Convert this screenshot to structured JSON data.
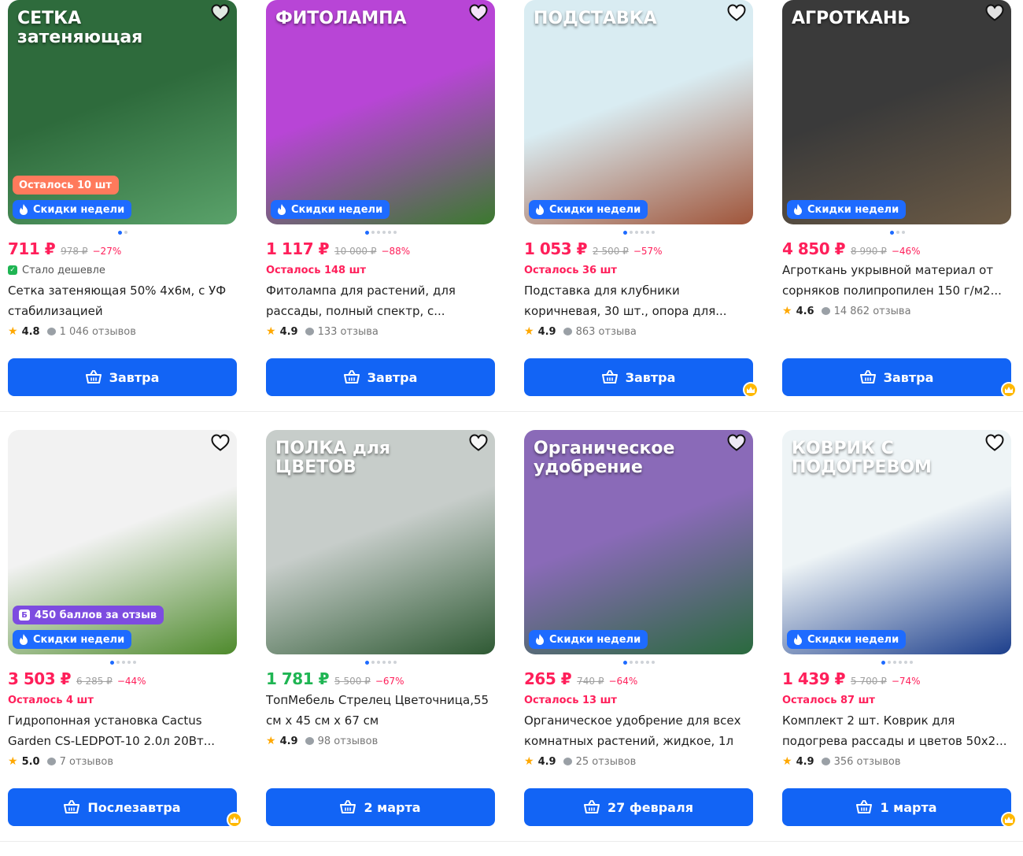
{
  "rows": [
    [
      {
        "price": "711 ₽",
        "old_price": "978 ₽",
        "discount": "−27%",
        "sub_type": "cheaper",
        "sub_text": "Стало дешевле",
        "title": "Сетка затеняющая 50% 4х6м, с УФ стабилизацией",
        "rating": "4.8",
        "reviews": "1 046 отзывов",
        "delivery": "Завтра",
        "badges": {
          "left": "Осталось 10 шт",
          "sale": "Скидки недели"
        },
        "dots": 2,
        "active_dot": 0,
        "crown": false,
        "image_colors": [
          "#2e6b3c",
          "#5aa26a"
        ],
        "image_label": "СЕТКА затеняющая"
      },
      {
        "price": "1 117 ₽",
        "old_price": "10 000 ₽",
        "discount": "−88%",
        "sub_type": "red",
        "sub_text": "Осталось 148 шт",
        "title": "Фитолампа для растений, для рассады, полный спектр, с...",
        "rating": "4.9",
        "reviews": "133 отзыва",
        "delivery": "Завтра",
        "badges": {
          "sale": "Скидки недели"
        },
        "dots": 6,
        "active_dot": 0,
        "crown": false,
        "image_colors": [
          "#b845d6",
          "#3b7a2e"
        ],
        "image_label": "ФИТОЛАМПА"
      },
      {
        "price": "1 053 ₽",
        "old_price": "2 500 ₽",
        "discount": "−57%",
        "sub_type": "red",
        "sub_text": "Осталось 36 шт",
        "title": "Подставка для клубники коричневая, 30 шт., опора для...",
        "rating": "4.9",
        "reviews": "863 отзыва",
        "delivery": "Завтра",
        "badges": {
          "sale": "Скидки недели"
        },
        "dots": 6,
        "active_dot": 0,
        "crown": true,
        "image_colors": [
          "#d9ecf2",
          "#a0553a"
        ],
        "image_label": "ПОДСТАВКА"
      },
      {
        "price": "4 850 ₽",
        "old_price": "8 990 ₽",
        "discount": "−46%",
        "sub_type": "none",
        "sub_text": "",
        "title": "Агроткань укрывной материал от сорняков полипропилен 150 г/м2...",
        "rating": "4.6",
        "reviews": "14 862 отзыва",
        "delivery": "Завтра",
        "badges": {
          "sale": "Скидки недели"
        },
        "dots": 3,
        "active_dot": 0,
        "crown": true,
        "image_colors": [
          "#3a3a3a",
          "#6b5a45"
        ],
        "image_label": "АГРОТКАНЬ"
      }
    ],
    [
      {
        "price": "3 503 ₽",
        "old_price": "6 285 ₽",
        "discount": "−44%",
        "sub_type": "red",
        "sub_text": "Осталось 4 шт",
        "title": "Гидропонная установка Cactus Garden CS-LEDPOT-10 2.0л 20Вт...",
        "rating": "5.0",
        "reviews": "7 отзывов",
        "delivery": "Послезавтра",
        "badges": {
          "points": "450 баллов за отзыв",
          "sale": "Скидки недели"
        },
        "dots": 5,
        "active_dot": 0,
        "crown": true,
        "image_colors": [
          "#f2f2f2",
          "#4e8a2c"
        ],
        "image_label": ""
      },
      {
        "price": "1 781 ₽",
        "old_price": "5 500 ₽",
        "discount": "−67%",
        "price_green": true,
        "sub_type": "none",
        "sub_text": "",
        "title": "ТопМебель Стрелец Цветочница,55 см х 45 см х 67 см",
        "rating": "4.9",
        "reviews": "98 отзывов",
        "delivery": "2 марта",
        "badges": {},
        "dots": 6,
        "active_dot": 0,
        "crown": false,
        "image_colors": [
          "#c7cdca",
          "#2f5a34"
        ],
        "image_label": "ПОЛКА для ЦВЕТОВ"
      },
      {
        "price": "265 ₽",
        "old_price": "740 ₽",
        "discount": "−64%",
        "sub_type": "red",
        "sub_text": "Осталось 13 шт",
        "title": "Органическое удобрение для всех комнатных растений, жидкое, 1л",
        "rating": "4.9",
        "reviews": "25 отзывов",
        "delivery": "27 февраля",
        "badges": {
          "sale": "Скидки недели"
        },
        "dots": 6,
        "active_dot": 0,
        "crown": false,
        "image_colors": [
          "#8a6ab8",
          "#2a6a3e"
        ],
        "image_label": "Органическое удобрение"
      },
      {
        "price": "1 439 ₽",
        "old_price": "5 700 ₽",
        "discount": "−74%",
        "sub_type": "red",
        "sub_text": "Осталось 87 шт",
        "title": "Комплект 2 шт. Коврик для подогрева рассады и цветов 50х2...",
        "rating": "4.9",
        "reviews": "356 отзывов",
        "delivery": "1 марта",
        "badges": {
          "sale": "Скидки недели"
        },
        "dots": 6,
        "active_dot": 0,
        "crown": true,
        "image_colors": [
          "#eef4f6",
          "#1d3f8c"
        ],
        "image_label": "КОВРИК С ПОДОГРЕВОМ"
      }
    ]
  ],
  "colors": {
    "accent": "#1264f5",
    "price": "#ff1f5a",
    "price_green": "#1fb553",
    "sale_badge": "#1e6bff",
    "crown": "#ffb800"
  },
  "icons": {
    "favorite": "heart-icon",
    "cart": "cart-icon",
    "fire": "fire-icon",
    "star": "star-icon",
    "reviews": "chat-bubble-icon",
    "plus": "crown-icon"
  }
}
